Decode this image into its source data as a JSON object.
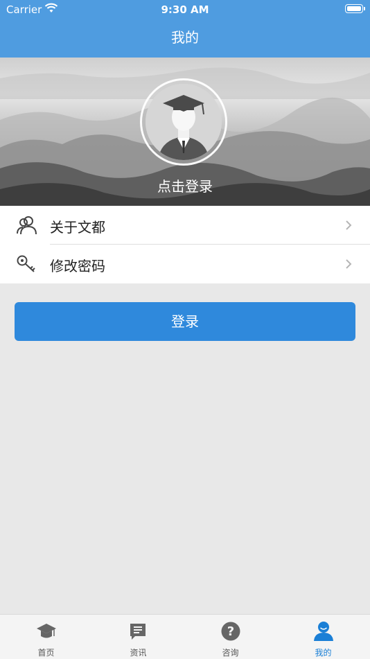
{
  "status_bar": {
    "carrier": "Carrier",
    "time": "9:30 AM"
  },
  "nav": {
    "title": "我的"
  },
  "profile": {
    "login_prompt": "点击登录"
  },
  "menu": [
    {
      "label": "关于文都",
      "icon": "users-icon"
    },
    {
      "label": "修改密码",
      "icon": "key-icon"
    }
  ],
  "login_button": {
    "label": "登录"
  },
  "tabs": [
    {
      "label": "首页",
      "icon": "graduation-cap-icon",
      "active": false
    },
    {
      "label": "资讯",
      "icon": "news-icon",
      "active": false
    },
    {
      "label": "咨询",
      "icon": "question-icon",
      "active": false
    },
    {
      "label": "我的",
      "icon": "person-icon",
      "active": true
    }
  ],
  "colors": {
    "primary": "#4f9ce0",
    "button": "#2f89dc",
    "active_tab": "#1a7fd6",
    "background": "#e8e8e8"
  }
}
